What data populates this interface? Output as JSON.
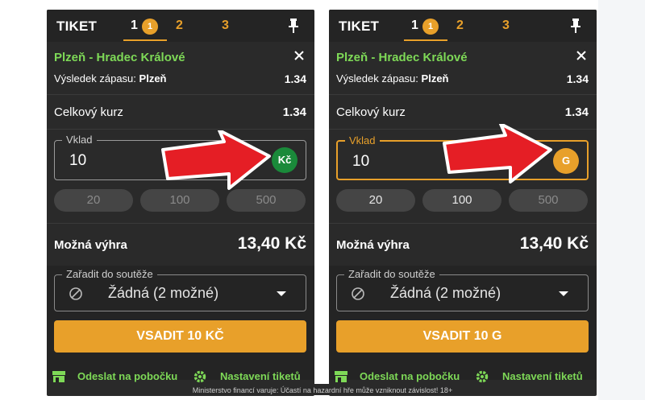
{
  "tickets": [
    {
      "title": "TIKET",
      "tabs": [
        "1",
        "2",
        "3"
      ],
      "badge": "1",
      "match": "Plzeň - Hradec Králové",
      "result_prefix": "Výsledek zápasu:",
      "result_pick": "Plzeň",
      "odd": "1.34",
      "total_label": "Celkový kurz",
      "total_value": "1.34",
      "stake_label": "Vklad",
      "stake_value": "10",
      "currency": "Kč",
      "currency_color": "#1a8a3a",
      "quick": [
        "20",
        "100",
        "500"
      ],
      "win_label": "Možná výhra",
      "win_value": "13,40 Kč",
      "comp_label": "Zařadit do soutěže",
      "comp_value": "Žádná (2 možné)",
      "place_label": "VSADIT 10 KČ",
      "send_label": "Odeslat na pobočku",
      "settings_label": "Nastavení tiketů"
    },
    {
      "title": "TIKET",
      "tabs": [
        "1",
        "2",
        "3"
      ],
      "badge": "1",
      "match": "Plzeň - Hradec Králové",
      "result_prefix": "Výsledek zápasu:",
      "result_pick": "Plzeň",
      "odd": "1.34",
      "total_label": "Celkový kurz",
      "total_value": "1.34",
      "stake_label": "Vklad",
      "stake_value": "10",
      "currency": "G",
      "currency_color": "#e8a02a",
      "quick": [
        "20",
        "100",
        "500"
      ],
      "win_label": "Možná výhra",
      "win_value": "13,40 Kč",
      "comp_label": "Zařadit do soutěže",
      "comp_value": "Žádná (2 možné)",
      "place_label": "VSADIT 10 G",
      "send_label": "Odeslat na pobočku",
      "settings_label": "Nastavení tiketů"
    }
  ],
  "disclaimer": "Ministerstvo financí varuje: Účastí na hazardní hře může vzniknout závislost! 18+",
  "colors": {
    "accent": "#e8a02a",
    "green_text": "#7ed957",
    "panel": "#2a2a2a",
    "arrow": "#e51e25"
  },
  "icons": [
    "pin-icon",
    "close-icon",
    "ban-icon",
    "caret-down-icon",
    "shop-icon",
    "gear-icon",
    "red-arrow"
  ]
}
